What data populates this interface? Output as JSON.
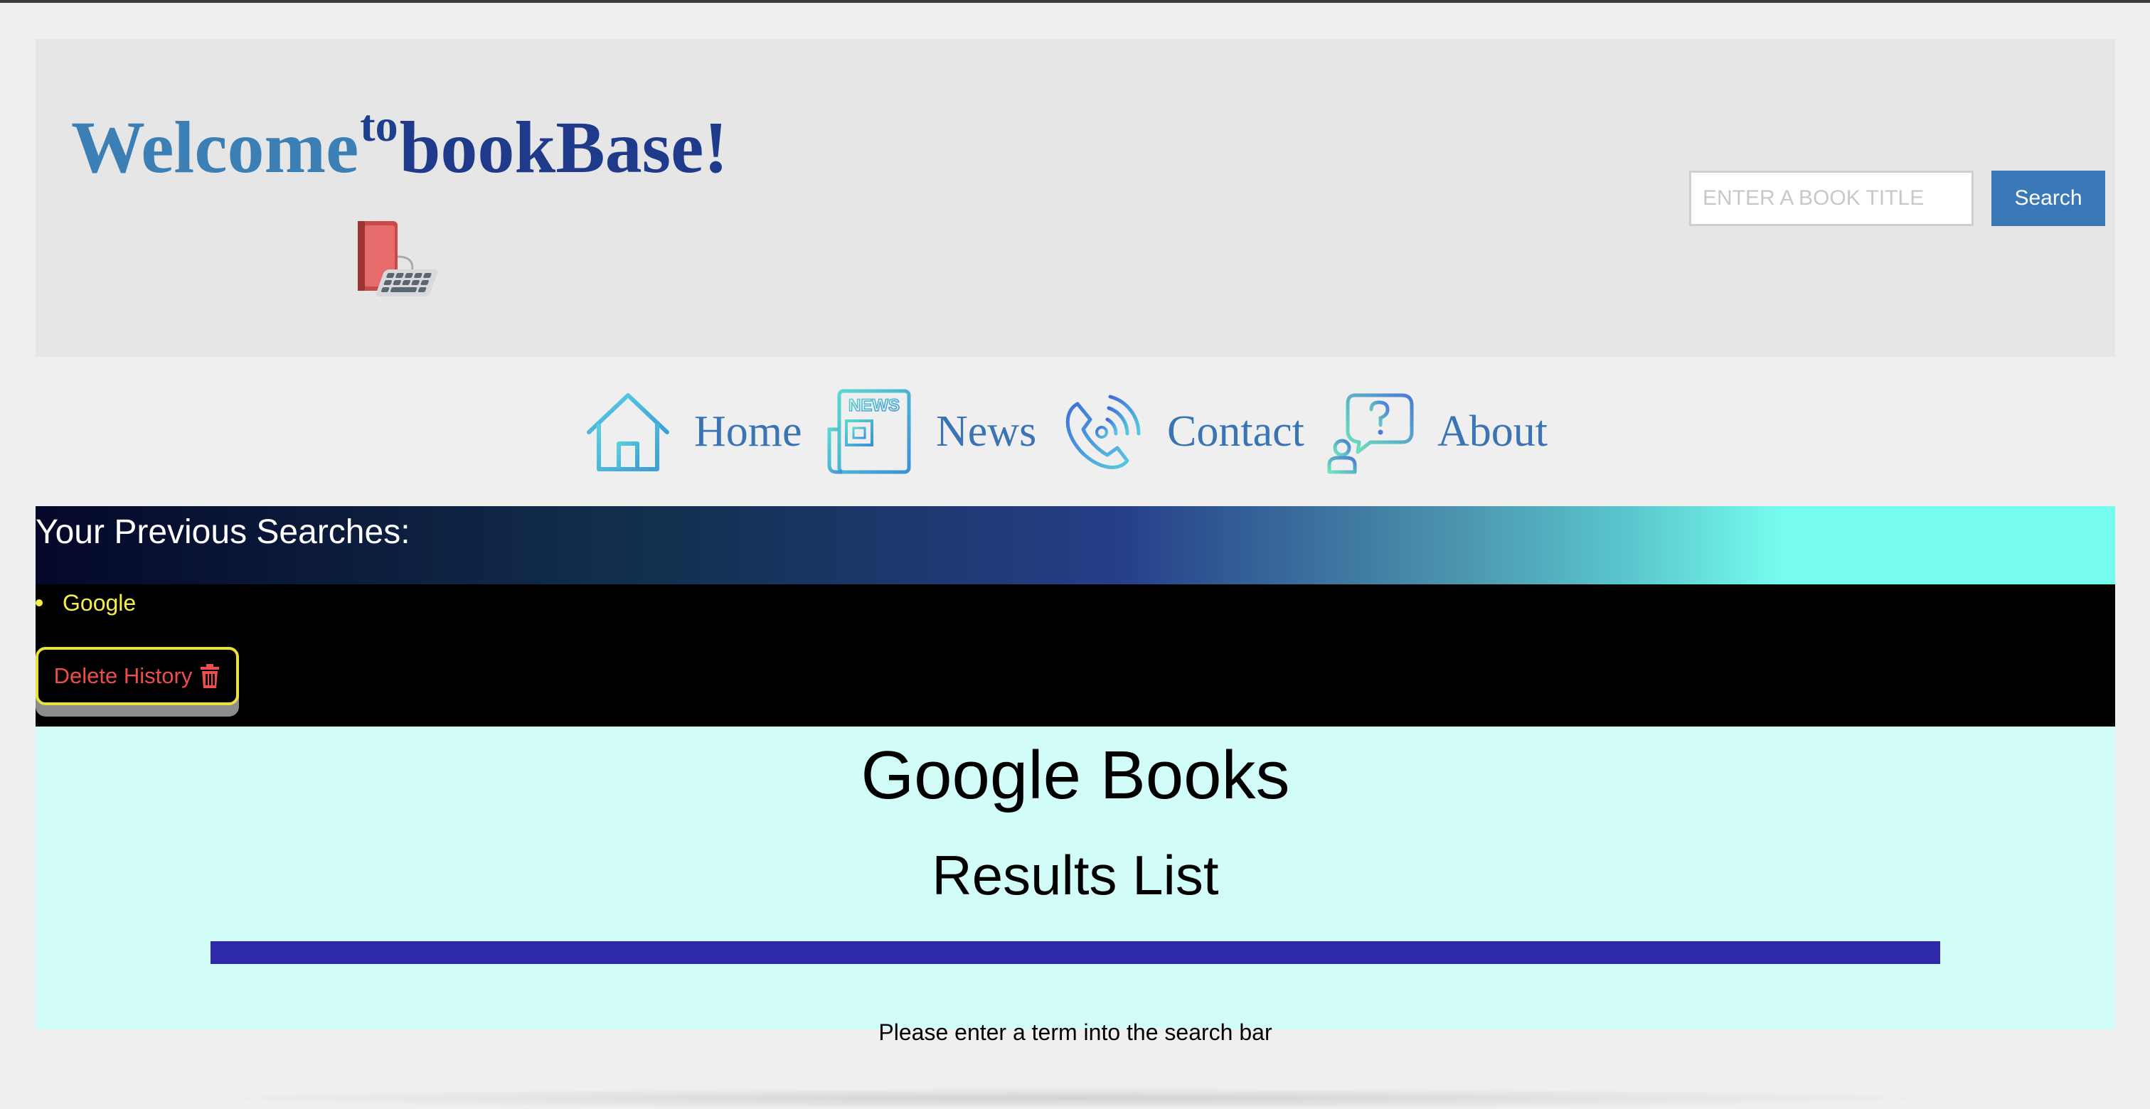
{
  "header": {
    "title_part1": "Welcome",
    "title_part2": "to",
    "title_part3": "bookBase!",
    "logo_icon": "book-computer-icon",
    "search": {
      "placeholder": "ENTER A BOOK TITLE",
      "value": "",
      "button_label": "Search"
    }
  },
  "nav": {
    "items": [
      {
        "label": "Home",
        "icon": "house-icon"
      },
      {
        "label": "News",
        "icon": "newspaper-icon"
      },
      {
        "label": "Contact",
        "icon": "phone-icon"
      },
      {
        "label": "About",
        "icon": "question-chat-icon"
      }
    ]
  },
  "previous_searches": {
    "title": "Your Previous Searches:",
    "items": [
      "Google"
    ],
    "delete_button_label": "Delete History",
    "delete_icon": "trash-icon"
  },
  "results": {
    "title": "Google Books",
    "subtitle": "Results List",
    "message": "Please enter a term into the search bar"
  },
  "colors": {
    "title_blue": "#3b7fb5",
    "nav_blue": "#3b74b4",
    "search_button": "#3a78b8",
    "highlight_yellow": "#f7ee49",
    "delete_red": "#ee4d4d",
    "results_background": "#d2fcf7",
    "results_bar": "#2e29a8"
  }
}
